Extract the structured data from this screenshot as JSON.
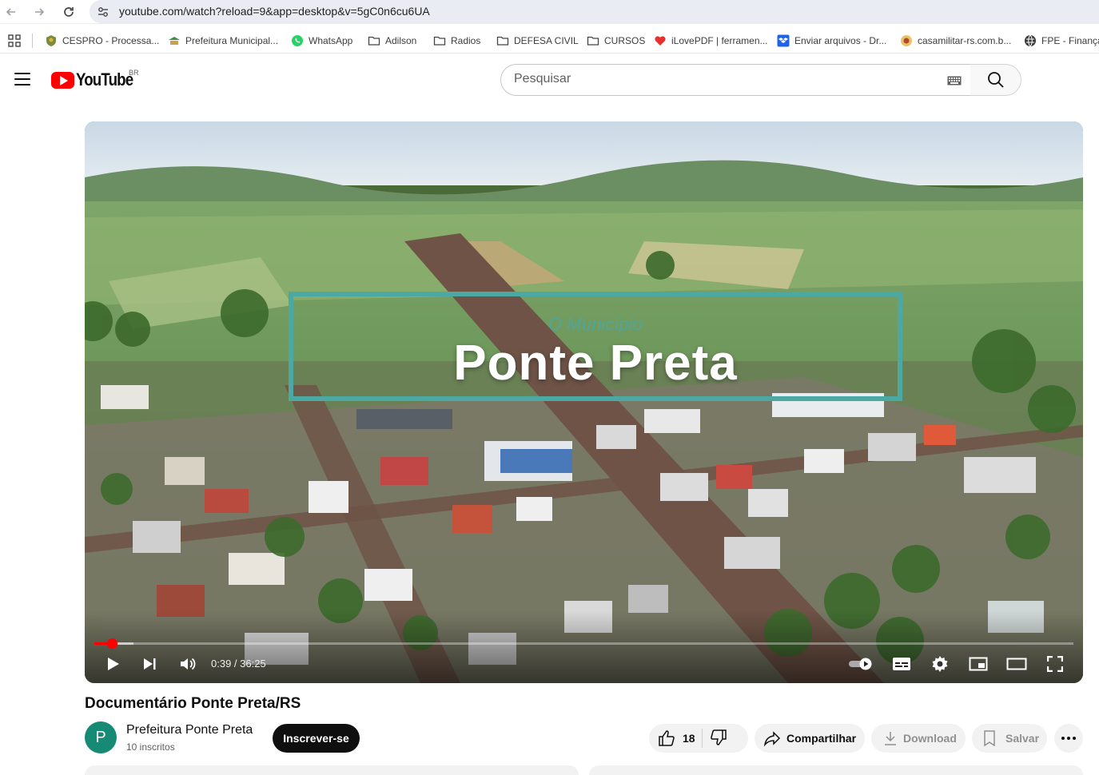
{
  "browser": {
    "url": "youtube.com/watch?reload=9&app=desktop&v=5gC0n6cu6UA",
    "bookmarks": [
      {
        "label": "CESPRO - Processa...",
        "icon": "crest-icon"
      },
      {
        "label": "Prefeitura Municipal...",
        "icon": "building-icon"
      },
      {
        "label": "WhatsApp",
        "icon": "whatsapp-icon"
      },
      {
        "label": "Adilson",
        "icon": "folder-icon"
      },
      {
        "label": "Radios",
        "icon": "folder-icon"
      },
      {
        "label": "DEFESA CIVIL",
        "icon": "folder-icon"
      },
      {
        "label": "CURSOS",
        "icon": "folder-icon"
      },
      {
        "label": "iLovePDF | ferramen...",
        "icon": "heart-icon"
      },
      {
        "label": "Enviar arquivos - Dr...",
        "icon": "dropbox-icon"
      },
      {
        "label": "casamilitar-rs.com.b...",
        "icon": "badge-icon"
      },
      {
        "label": "FPE - Finanças",
        "icon": "globe-icon"
      }
    ]
  },
  "youtube": {
    "logo_text": "YouTube",
    "country_code": "BR",
    "search_placeholder": "Pesquisar"
  },
  "player": {
    "overlay_small": "O Município",
    "overlay_title": "Ponte Preta",
    "current_time": "0:39",
    "duration": "36:25",
    "time_display": "0:39 / 36:25",
    "progress_fraction": 0.018,
    "buffer_fraction": 0.04,
    "accent": "#ff0000",
    "frame_color": "#4ba8a3"
  },
  "video": {
    "title": "Documentário Ponte Preta/RS",
    "channel_name": "Prefeitura Ponte Preta",
    "channel_initial": "P",
    "subscribers": "10 inscritos",
    "subscribe_label": "Inscrever-se",
    "likes": "18",
    "share_label": "Compartilhar",
    "download_label": "Download",
    "save_label": "Salvar",
    "avatar_color": "#168a75"
  }
}
